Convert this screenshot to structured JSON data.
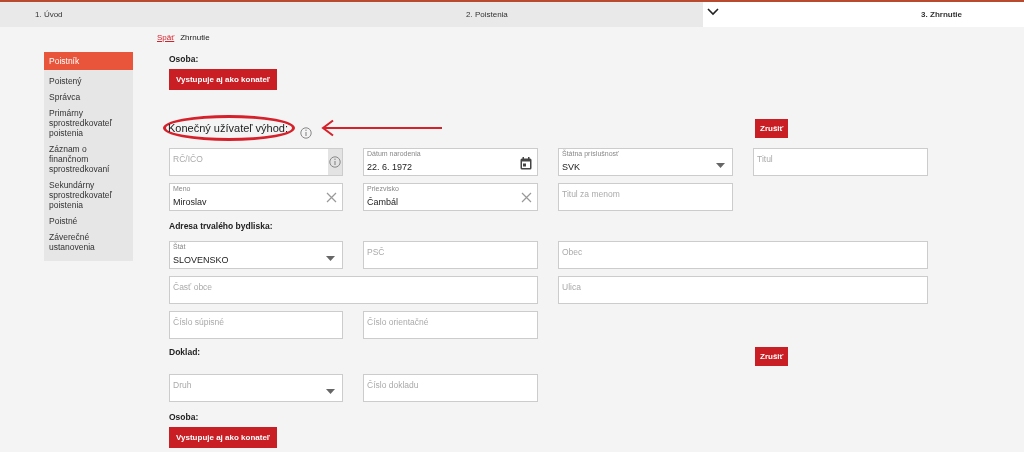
{
  "tabs": [
    {
      "label": "1. Úvod",
      "selected": false
    },
    {
      "label": "2. Poistenia",
      "selected": false
    },
    {
      "label": "3. Zhrnutie",
      "selected": true
    }
  ],
  "breadcrumb": {
    "back": "Späť",
    "current": "Zhrnutie"
  },
  "sidebar": {
    "items": [
      {
        "label": "Poistník",
        "selected": true
      },
      {
        "label": "Poistený",
        "selected": false
      },
      {
        "label": "Správca",
        "selected": false
      },
      {
        "label": "Primárny sprostredkovateľ poistenia",
        "selected": false
      },
      {
        "label": "Záznam o finančnom sprostredkovaní",
        "selected": false
      },
      {
        "label": "Sekundárny sprostredkovateľ poistenia",
        "selected": false
      },
      {
        "label": "Poistné",
        "selected": false
      },
      {
        "label": "Záverečné ustanovenia",
        "selected": false
      }
    ]
  },
  "blocks": [
    {
      "kind": "label",
      "text": "Osoba:"
    },
    {
      "kind": "button",
      "text": "Vystupuje aj ako konateľ"
    },
    {
      "kind": "heading",
      "text": "Konečný užívateľ výhod:",
      "cancel": "Zrušiť"
    },
    {
      "kind": "fields",
      "fields": [
        {
          "kind": "text",
          "placeholder": "RČ/IČO",
          "info": true
        },
        {
          "kind": "date",
          "label": "Dátum narodenia",
          "value": "22. 6. 1972"
        },
        {
          "kind": "select",
          "label": "Štátna príslušnosť",
          "value": "SVK"
        },
        {
          "kind": "text",
          "placeholder": "Titul"
        }
      ]
    },
    {
      "kind": "fields",
      "fields": [
        {
          "kind": "text",
          "label": "Meno",
          "value": "Miroslav",
          "clearable": true
        },
        {
          "kind": "text",
          "label": "Priezvisko",
          "value": "Čambál",
          "clearable": true
        },
        {
          "kind": "text",
          "placeholder": "Titul za menom"
        }
      ]
    },
    {
      "kind": "label",
      "text": "Adresa trvalého bydliska:"
    },
    {
      "kind": "fields",
      "fields": [
        {
          "kind": "select",
          "label": "Štát",
          "value": "SLOVENSKO"
        },
        {
          "kind": "text",
          "placeholder": "PSČ"
        },
        {
          "kind": "wide-text",
          "placeholder": "Obec"
        }
      ]
    },
    {
      "kind": "fields",
      "fields": [
        {
          "kind": "wide-text",
          "placeholder": "Časť obce"
        },
        {
          "kind": "wide-text",
          "placeholder": "Ulica"
        }
      ]
    },
    {
      "kind": "fields",
      "fields": [
        {
          "kind": "text",
          "placeholder": "Číslo súpisné"
        },
        {
          "kind": "text",
          "placeholder": "Číslo orientačné"
        }
      ]
    },
    {
      "kind": "label",
      "text": "Doklad:",
      "cancel": "Zrušiť"
    },
    {
      "kind": "fields",
      "fields": [
        {
          "kind": "select",
          "placeholder": "Druh"
        },
        {
          "kind": "text",
          "placeholder": "Číslo dokladu"
        }
      ]
    },
    {
      "kind": "label",
      "text": "Osoba:"
    },
    {
      "kind": "button",
      "text": "Vystupuje aj ako konateľ"
    }
  ]
}
